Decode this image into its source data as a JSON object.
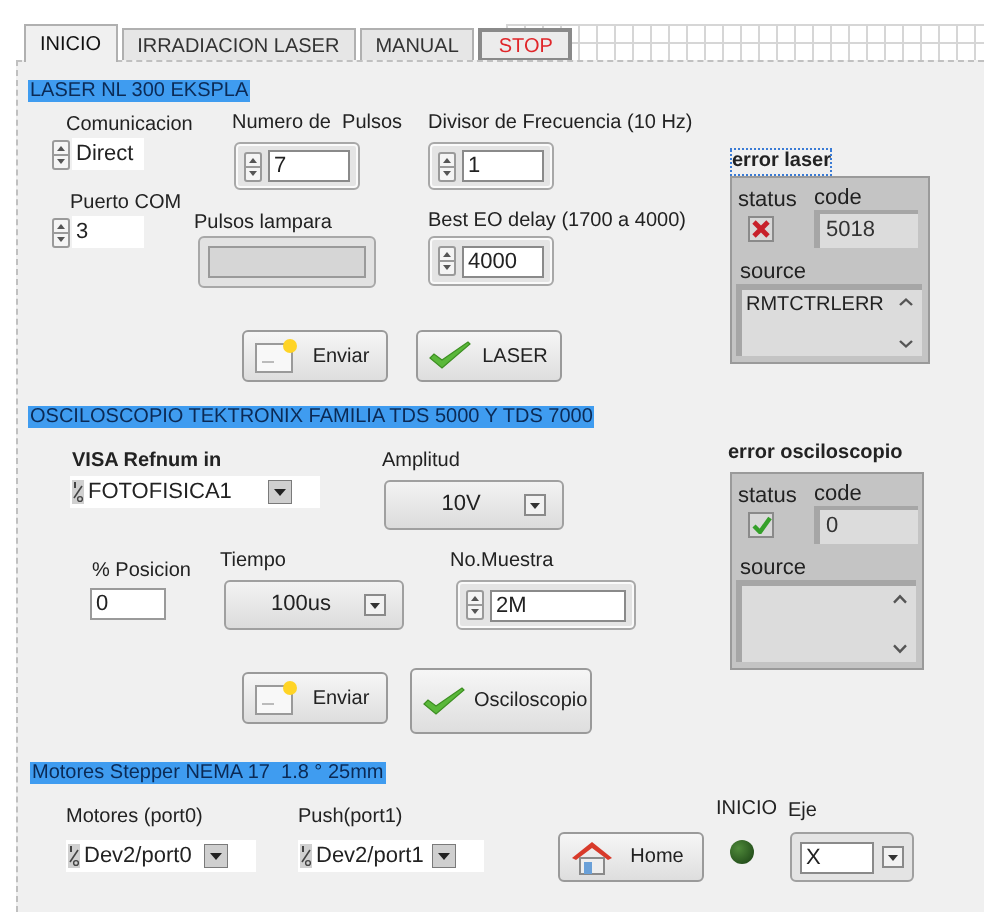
{
  "tabs": [
    {
      "label": "INICIO",
      "selected": true
    },
    {
      "label": "IRRADIACION LASER",
      "selected": false
    },
    {
      "label": "MANUAL",
      "selected": false
    }
  ],
  "stop_button": {
    "label": "STOP"
  },
  "laser": {
    "title": "LASER NL 300 EKSPLA",
    "comunicacion": {
      "label": "Comunicacion",
      "value": "Direct"
    },
    "puerto_com": {
      "label": "Puerto COM",
      "value": "3"
    },
    "numero_pulsos": {
      "label": "Numero de  Pulsos",
      "value": "7"
    },
    "divisor": {
      "label": "Divisor de Frecuencia (10 Hz)",
      "value": "1"
    },
    "pulsos_lampara": {
      "label": "Pulsos lampara"
    },
    "best_eo_delay": {
      "label": "Best EO delay (1700 a 4000)",
      "value": "4000"
    },
    "error": {
      "label": "error laser",
      "status_label": "status",
      "code_label": "code",
      "source_label": "source",
      "status": true,
      "code": "5018",
      "source": "RMTCTRLERR"
    },
    "buttons": [
      {
        "kind": "send",
        "label": "Enviar"
      },
      {
        "kind": "check",
        "label": "LASER"
      }
    ]
  },
  "osciloscopio": {
    "title": "OSCILOSCOPIO TEKTRONIX FAMILIA TDS 5000 Y TDS 7000",
    "visa": {
      "label": "VISA Refnum in",
      "value": "FOTOFISICA1"
    },
    "amplitud": {
      "label": "Amplitud",
      "value": "10V"
    },
    "posicion": {
      "label": "% Posicion",
      "value": "0"
    },
    "tiempo": {
      "label": "Tiempo",
      "value": "100us"
    },
    "muestra": {
      "label": "No.Muestra",
      "value": "2M"
    },
    "error": {
      "label": "error osciloscopio",
      "status_label": "status",
      "code_label": "code",
      "source_label": "source",
      "status": false,
      "code": "0"
    },
    "buttons": [
      {
        "kind": "send",
        "label": "Enviar"
      },
      {
        "kind": "check",
        "label": "Osciloscopio"
      }
    ]
  },
  "motores": {
    "title": "Motores Stepper NEMA 17  1.8 ° 25mm",
    "port0": {
      "label": "Motores (port0)",
      "value": "Dev2/port0"
    },
    "port1": {
      "label": "Push(port1)",
      "value": "Dev2/port1"
    },
    "home_button": {
      "label": "Home"
    },
    "led": {
      "label": "INICIO",
      "on": false
    },
    "eje": {
      "label": "Eje",
      "value": "X"
    }
  }
}
